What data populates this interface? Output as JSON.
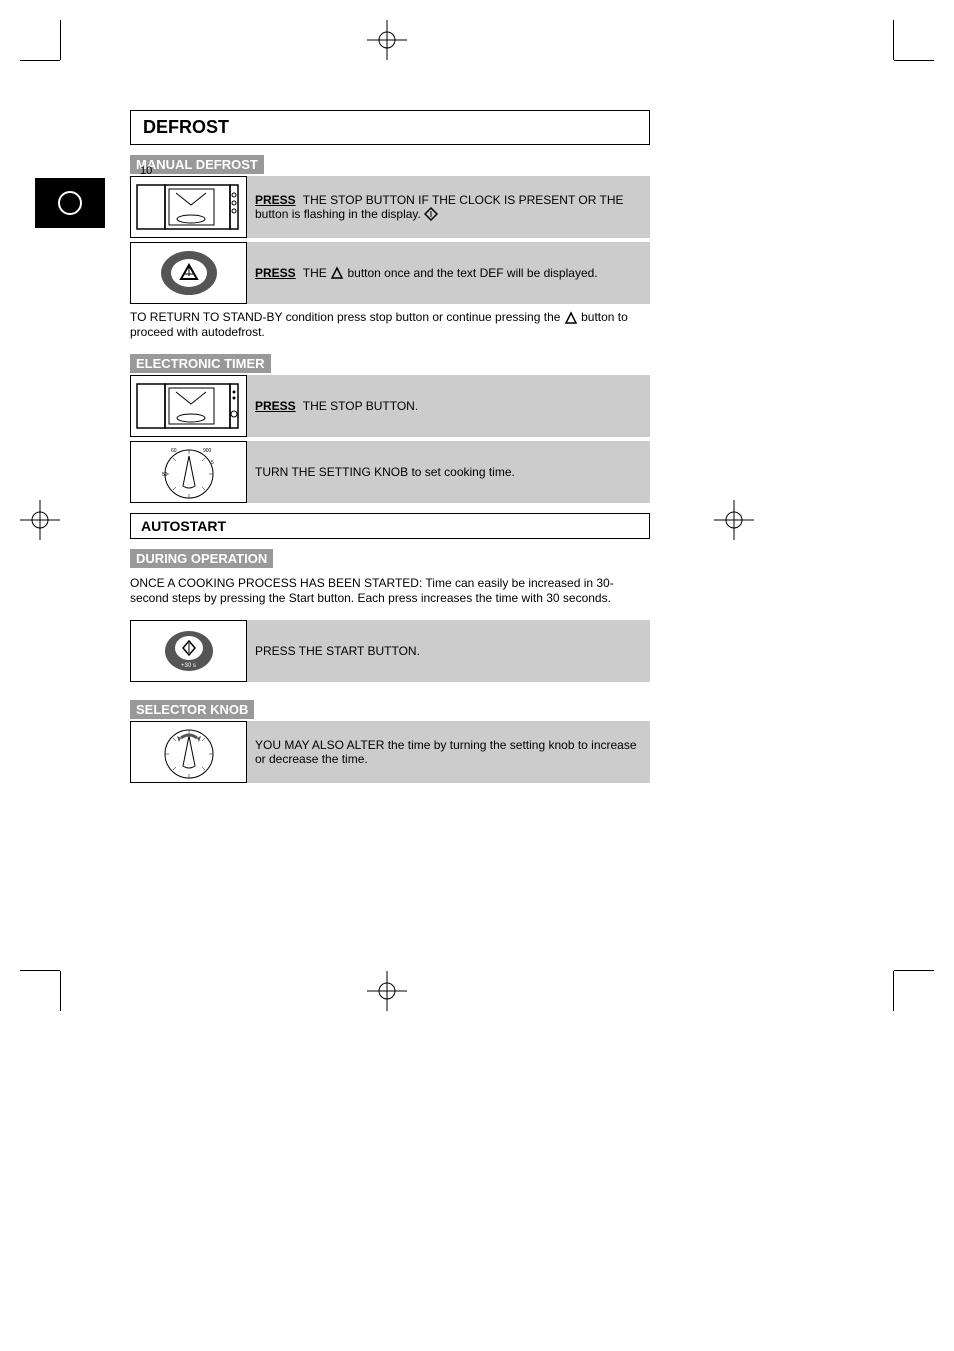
{
  "page_title": "DEFROST",
  "page_number": "10",
  "manual": {
    "header": "MANUAL DEFROST",
    "step1_lead": "PRESS",
    "step1_text": " THE STOP BUTTON IF THE CLOCK IS PRESENT OR THE button is flashing in the display.",
    "step2_lead": "PRESS",
    "step2_text": " THE button once and the text DEF will be displayed.",
    "note": "TO RETURN TO STAND-BY condition press stop button or continue pressing the button to proceed with autodefrost."
  },
  "electronic": {
    "header": "ELECTRONIC TIMER",
    "step1_lead": "PRESS",
    "step1_text": " THE STOP BUTTON.",
    "step2_text": "TURN THE SETTING KNOB to set cooking time."
  },
  "autostart_title": "AUTOSTART",
  "during_op": {
    "header": "DURING OPERATION",
    "intro": "ONCE A COOKING PROCESS HAS BEEN STARTED: Time can easily be increased in 30-second steps by pressing the Start button. Each press increases the time with 30 seconds.",
    "step_text": "PRESS THE START BUTTON."
  },
  "selector": {
    "header": "SELECTOR KNOB",
    "step_text": "YOU MAY ALSO ALTER the time by turning the setting knob to increase or decrease the time."
  }
}
